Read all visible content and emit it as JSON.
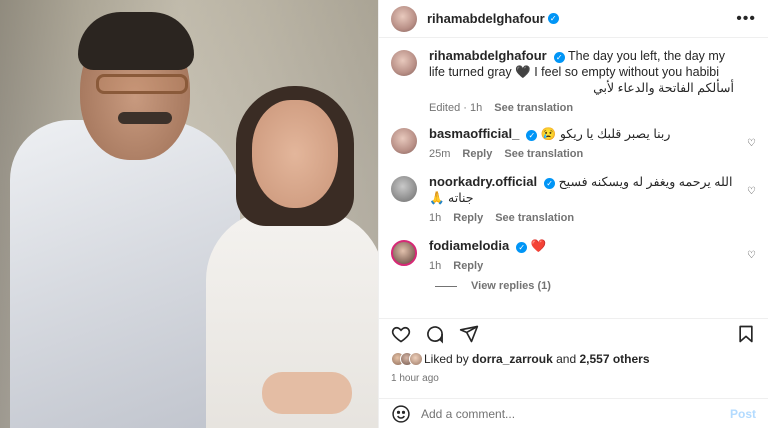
{
  "post": {
    "username": "rihamabdelghafour",
    "more_icon": "more-horizontal-icon"
  },
  "caption": {
    "username": "rihamabdelghafour",
    "text_en": "The day you left, the day my life turned gray 🖤 I feel so empty without you habibi",
    "text_ar": "أسألكم الفاتحة والدعاء لأبي",
    "edited": "Edited",
    "age": "1h",
    "see_translation": "See translation"
  },
  "comments": [
    {
      "username": "basmaofficial_",
      "text": "ربنا يصبر قلبك يا ريكو 😢",
      "age": "25m",
      "reply": "Reply",
      "see_translation": "See translation"
    },
    {
      "username": "noorkadry.official",
      "text": "الله يرحمه ويغفر له ويسكنه فسيح جناته 🙏",
      "age": "1h",
      "reply": "Reply",
      "see_translation": "See translation"
    },
    {
      "username": "fodiamelodia",
      "text": "❤️",
      "age": "1h",
      "reply": "Reply"
    }
  ],
  "view_replies": "View replies (1)",
  "likes": {
    "liked_by": "Liked by",
    "user": "dorra_zarrouk",
    "and": "and",
    "others": "2,557 others"
  },
  "timestamp": "1 hour ago",
  "add_comment": {
    "placeholder": "Add a comment...",
    "post_label": "Post"
  },
  "colors": {
    "accent": "#0095f6",
    "heart": "#ed4956",
    "muted": "#737373",
    "post_disabled": "#b3dbff"
  }
}
